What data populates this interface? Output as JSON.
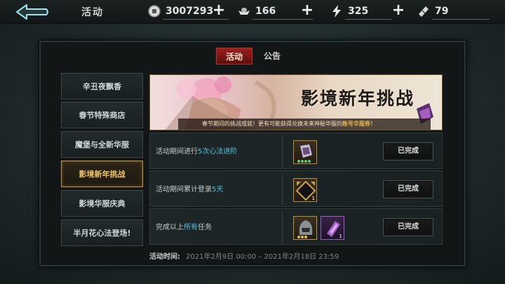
{
  "header": {
    "title": "活动",
    "resources": [
      {
        "name": "coin",
        "icon": "coin-icon",
        "value": "3007293"
      },
      {
        "name": "ingot",
        "icon": "ingot-icon",
        "value": "166"
      },
      {
        "name": "stamina",
        "icon": "lightning-icon",
        "value": "325"
      },
      {
        "name": "ticket",
        "icon": "ticket-icon",
        "value": "79"
      }
    ]
  },
  "tabs": [
    {
      "label": "活动",
      "active": true
    },
    {
      "label": "公告",
      "active": false
    }
  ],
  "sidebar": {
    "items": [
      {
        "label": "辛丑夜飘香",
        "active": false
      },
      {
        "label": "春节特殊商店",
        "active": false
      },
      {
        "label": "魔堡与全新华服",
        "active": false
      },
      {
        "label": "影境新年挑战",
        "active": true
      },
      {
        "label": "影境华服庆典",
        "active": false
      },
      {
        "label": "半月花心法登场!",
        "active": false
      }
    ]
  },
  "banner": {
    "title": "影境新年挑战",
    "desc_prefix": "春节期间的挑战成就！更有可能获得兑换未来神秘华服的",
    "desc_highlight": "账号华服券",
    "desc_suffix": "！"
  },
  "tasks": [
    {
      "text_pre": "活动期间进行",
      "text_hl": "5次心法进阶",
      "text_post": "",
      "rewards": [
        {
          "icon": "scroll-icon",
          "count": ""
        }
      ],
      "status": "已完成"
    },
    {
      "text_pre": "活动期间累计登录",
      "text_hl": "5天",
      "text_post": "",
      "rewards": [
        {
          "icon": "frame-icon",
          "count": "1"
        }
      ],
      "status": "已完成"
    },
    {
      "text_pre": "完成以上",
      "text_hl": "所有",
      "text_post": "任务",
      "rewards": [
        {
          "icon": "helmet-icon",
          "count": ""
        },
        {
          "icon": "purple-ticket-icon",
          "count": "1"
        }
      ],
      "status": "已完成"
    }
  ],
  "period": {
    "label": "活动时间:",
    "value": "2021年2月9日 00:00 – 2021年2月18日 23:59"
  },
  "colors": {
    "accent_red": "#9a1f1f",
    "gold": "#c59a40",
    "highlight_blue": "#56c2e0"
  }
}
